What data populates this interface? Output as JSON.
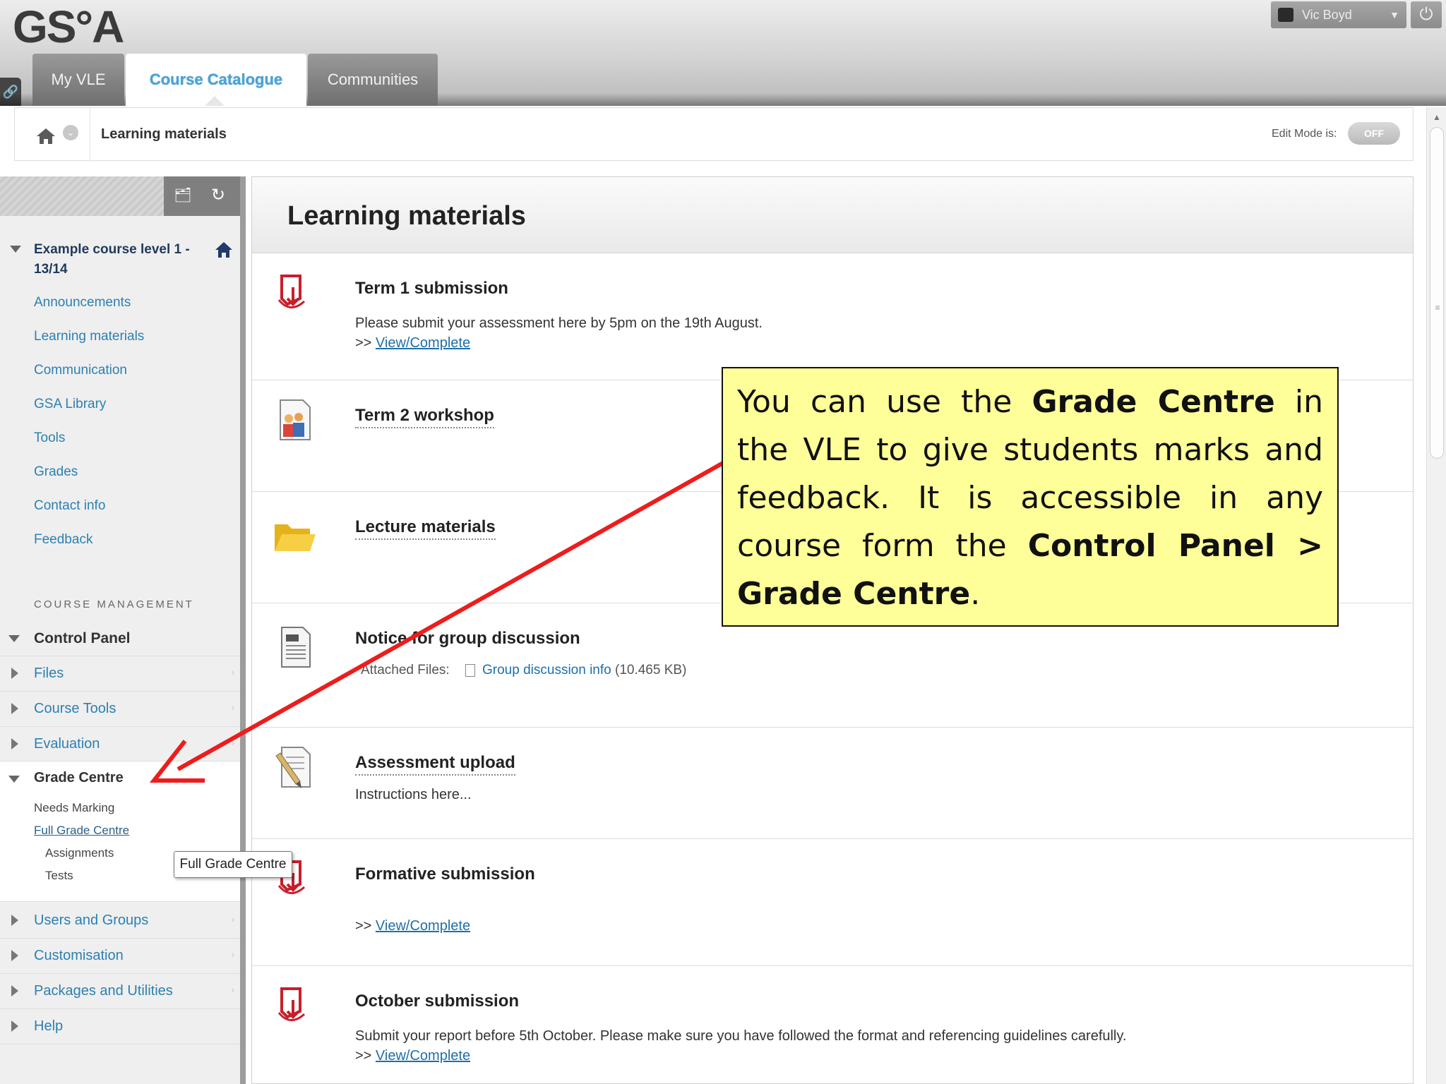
{
  "header": {
    "logo": "GS°A",
    "tabs": [
      {
        "label": "My VLE"
      },
      {
        "label": "Course Catalogue"
      },
      {
        "label": "Communities"
      }
    ],
    "user_name": "Vic Boyd"
  },
  "breadcrumb": {
    "current": "Learning materials",
    "edit_mode_label": "Edit Mode is:",
    "edit_mode_state": "OFF"
  },
  "sidebar": {
    "course_title": "Example course level 1 - 13/14",
    "menu": [
      {
        "label": "Announcements"
      },
      {
        "label": "Learning materials"
      },
      {
        "label": "Communication"
      },
      {
        "label": "GSA Library"
      },
      {
        "label": "Tools"
      },
      {
        "label": "Grades"
      },
      {
        "label": "Contact info"
      },
      {
        "label": "Feedback"
      }
    ],
    "course_management_heading": "COURSE MANAGEMENT",
    "control_panel": "Control Panel",
    "cp_items_top": [
      {
        "label": "Files"
      },
      {
        "label": "Course Tools"
      },
      {
        "label": "Evaluation"
      }
    ],
    "grade_centre": {
      "label": "Grade Centre",
      "items": [
        {
          "label": "Needs Marking"
        },
        {
          "label": "Full Grade Centre"
        },
        {
          "label": "Assignments"
        },
        {
          "label": "Tests"
        }
      ]
    },
    "cp_items_bottom": [
      {
        "label": "Users and Groups"
      },
      {
        "label": "Customisation"
      },
      {
        "label": "Packages and Utilities"
      },
      {
        "label": "Help"
      }
    ]
  },
  "tooltip": "Full Grade Centre",
  "content": {
    "page_title": "Learning materials",
    "items": [
      {
        "title": "Term 1 submission",
        "desc": "Please submit your assessment here by 5pm on the 19th August.",
        "link_prefix": ">>",
        "link": "View/Complete"
      },
      {
        "title": "Term 2 workshop"
      },
      {
        "title": "Lecture materials"
      },
      {
        "title": "Notice for group discussion",
        "attached_label": "Attached Files:",
        "file_name": "Group discussion info",
        "file_size": "(10.465 KB)"
      },
      {
        "title": "Assessment upload",
        "desc": "Instructions here..."
      },
      {
        "title": "Formative submission",
        "link_prefix": ">>",
        "link": "View/Complete"
      },
      {
        "title": "October submission",
        "desc": "Submit your report before 5th October. Please make sure you have followed the format and referencing guidelines carefully.",
        "link_prefix": ">>",
        "link": "View/Complete"
      }
    ]
  },
  "annotation": {
    "part1": "You can use the ",
    "bold1": "Grade Centre",
    "part2": " in the VLE to give students marks and feedback. It is accessible in any course form the ",
    "bold2": "Control Panel > Grade Centre",
    "part3": ".",
    "arrow_color": "#ee1c1c"
  },
  "colors": {
    "accent_link": "#2c80b1",
    "active_tab_text": "#4aa3d8",
    "annotation_bg": "#ffff99"
  }
}
